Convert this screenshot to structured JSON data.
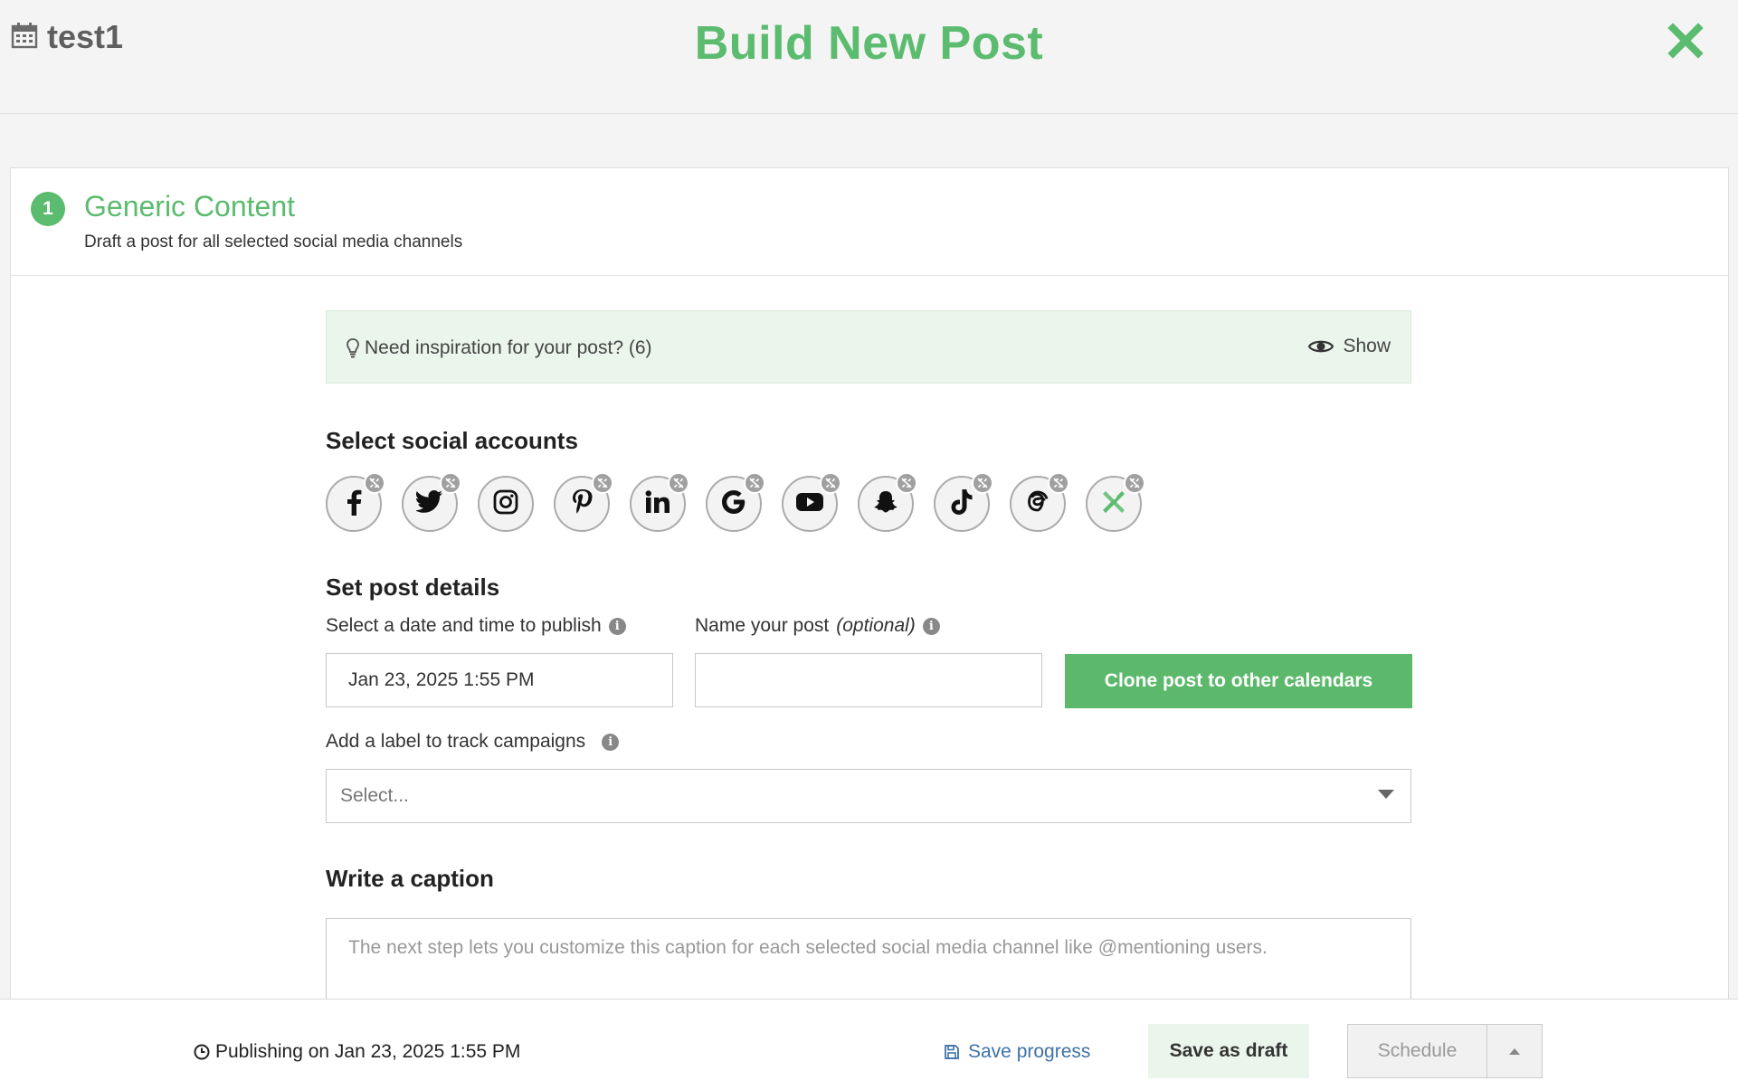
{
  "header": {
    "calendar_name": "test1",
    "title": "Build New Post"
  },
  "step": {
    "number": "1",
    "title": "Generic Content",
    "subtitle": "Draft a post for all selected social media channels"
  },
  "inspiration": {
    "label": "Need inspiration for your post? (6)",
    "show_label": "Show"
  },
  "social": {
    "heading": "Select social accounts",
    "accounts": [
      {
        "name": "facebook",
        "glyph": "f",
        "linked": false
      },
      {
        "name": "twitter",
        "glyph": "t",
        "linked": false
      },
      {
        "name": "instagram",
        "glyph": "ig",
        "linked": true
      },
      {
        "name": "pinterest",
        "glyph": "p",
        "linked": false
      },
      {
        "name": "linkedin",
        "glyph": "in",
        "linked": false
      },
      {
        "name": "google",
        "glyph": "G",
        "linked": false
      },
      {
        "name": "youtube",
        "glyph": "yt",
        "linked": false
      },
      {
        "name": "snapchat",
        "glyph": "sc",
        "linked": false
      },
      {
        "name": "tiktok",
        "glyph": "tt",
        "linked": false
      },
      {
        "name": "threads",
        "glyph": "@",
        "linked": false
      },
      {
        "name": "other",
        "glyph": "x",
        "linked": false
      }
    ]
  },
  "details": {
    "heading": "Set post details",
    "date_label": "Select a date and time to publish",
    "date_value": "Jan 23, 2025 1:55 PM",
    "name_label": "Name your post",
    "name_optional": "(optional)",
    "name_value": "",
    "clone_button": "Clone post to other calendars",
    "campaign_label": "Add a label to track campaigns",
    "campaign_placeholder": "Select..."
  },
  "caption": {
    "heading": "Write a caption",
    "placeholder": "The next step lets you customize this caption for each selected social media channel like @mentioning users."
  },
  "footer": {
    "publishing": "Publishing on Jan 23, 2025 1:55 PM",
    "save_progress": "Save progress",
    "save_draft": "Save as draft",
    "schedule": "Schedule"
  },
  "colors": {
    "brand_green": "#5bbb6e",
    "link_blue": "#3d72a8",
    "inspiration_bg": "#eaf5ec"
  }
}
